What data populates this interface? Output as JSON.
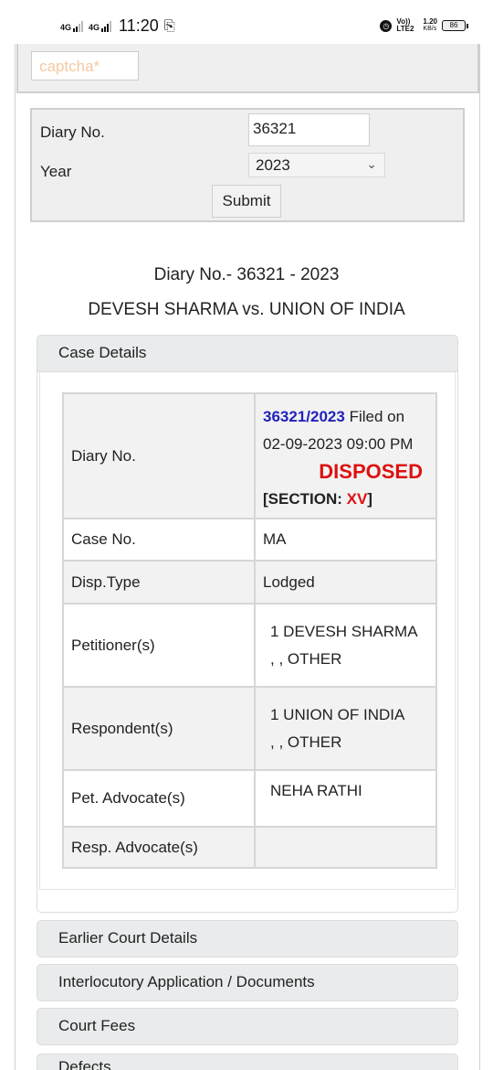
{
  "status": {
    "net1": "4G",
    "net2": "4G",
    "time": "11:20",
    "volte": "Vo)) LTE2",
    "speed": "1.20",
    "speed_unit": "KB/s",
    "battery": "86"
  },
  "form": {
    "captcha_placeholder": "captcha*",
    "diary_label": "Diary No.",
    "diary_value": "36321",
    "year_label": "Year",
    "year_value": "2023",
    "submit_label": "Submit"
  },
  "case": {
    "title": "Diary No.- 36321 - 2023",
    "parties": "DEVESH SHARMA vs. UNION OF INDIA"
  },
  "details": {
    "header": "Case Details",
    "rows": {
      "diary_label": "Diary No.",
      "diary_number": "36321/2023",
      "filed_on": "Filed on",
      "filed_date": "02-09-2023 09:00 PM",
      "status": "DISPOSED",
      "section_prefix": "[SECTION: ",
      "section_value": "XV",
      "section_suffix": "]",
      "case_no_label": "Case No.",
      "case_no_value": "MA",
      "disp_type_label": "Disp.Type",
      "disp_type_value": "Lodged",
      "petitioner_label": "Petitioner(s)",
      "petitioner_line1": "1 DEVESH SHARMA",
      "petitioner_line2": ", , OTHER",
      "respondent_label": "Respondent(s)",
      "respondent_line1": "1 UNION OF INDIA",
      "respondent_line2": ", , OTHER",
      "pet_adv_label": "Pet. Advocate(s)",
      "pet_adv_value": "NEHA RATHI",
      "resp_adv_label": "Resp. Advocate(s)",
      "resp_adv_value": ""
    }
  },
  "sections": {
    "earlier": "Earlier Court Details",
    "ia": "Interlocutory Application / Documents",
    "fees": "Court Fees",
    "defects": "Defects"
  },
  "colors": {
    "link_blue": "#2222bb",
    "status_red": "#dd1111",
    "panel_grey": "#e9ebec"
  }
}
